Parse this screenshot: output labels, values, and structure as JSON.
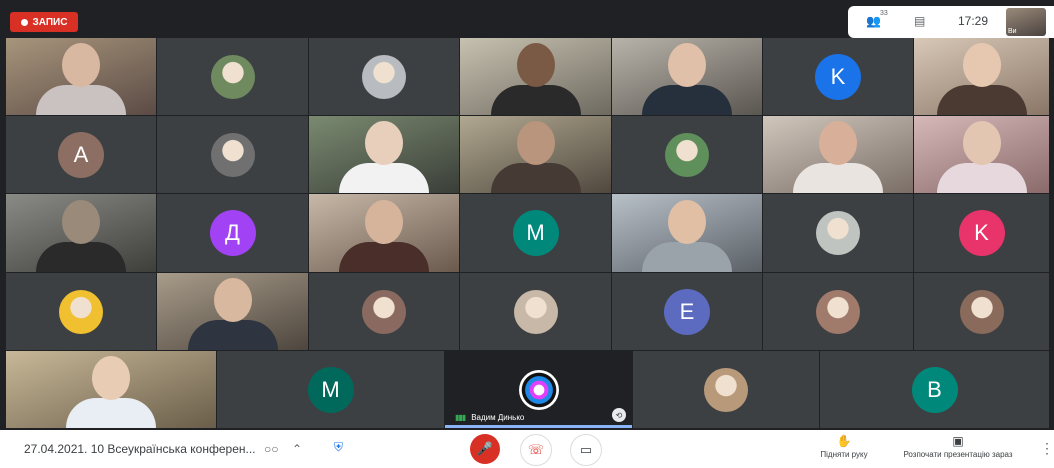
{
  "record_badge": {
    "label": "ЗАПИС",
    "color": "#d93025"
  },
  "topbar": {
    "participants_icon": "people-icon",
    "participants_count": "33",
    "chat_icon": "chat-icon",
    "time": "17:29",
    "self_label": "Ви"
  },
  "tiles": [
    {
      "id": "t1",
      "kind": "photo",
      "a": "#a8957c",
      "b": "#5b4b45",
      "head": "#d8b8a0",
      "body": "#c9c2c0"
    },
    {
      "id": "t2",
      "kind": "pic",
      "pic": "#6f8a5f"
    },
    {
      "id": "t3",
      "kind": "pic",
      "pic": "#b8bcc0"
    },
    {
      "id": "t4",
      "kind": "photo",
      "a": "#c7c1b0",
      "b": "#6e6a60",
      "head": "#7a5a45",
      "body": "#2a2a2a"
    },
    {
      "id": "t5",
      "kind": "photo",
      "a": "#b8b3aa",
      "b": "#5a5650",
      "head": "#e0c0a8",
      "body": "#26303c"
    },
    {
      "id": "t6",
      "kind": "letter",
      "letter": "K",
      "color": "#1a73e8"
    },
    {
      "id": "t7",
      "kind": "photo",
      "a": "#d8c8b8",
      "b": "#8a7666",
      "head": "#e6c8b0",
      "body": "#4a3a32"
    },
    {
      "id": "t8",
      "kind": "letter",
      "letter": "A",
      "color": "#8d6e63"
    },
    {
      "id": "t9",
      "kind": "pic",
      "pic": "#707070"
    },
    {
      "id": "t10",
      "kind": "photo",
      "a": "#7a8a70",
      "b": "#3a3e38",
      "head": "#e8cfbc",
      "body": "#f2f2f2"
    },
    {
      "id": "t11",
      "kind": "photo",
      "a": "#b0a890",
      "b": "#50483e",
      "head": "#b8957c",
      "body": "#463a34"
    },
    {
      "id": "t12",
      "kind": "pic",
      "pic": "#5f8f5a"
    },
    {
      "id": "t13",
      "kind": "photo",
      "a": "#cfc6bc",
      "b": "#7a6e66",
      "head": "#d8b09a",
      "body": "#e9e4e0"
    },
    {
      "id": "t14",
      "kind": "photo",
      "a": "#d6b8b8",
      "b": "#8a6a6a",
      "head": "#e2c6b2",
      "body": "#e6d8dc"
    },
    {
      "id": "t15",
      "kind": "photo",
      "a": "#8a8a86",
      "b": "#3e3e3a",
      "head": "#9a8a7a",
      "body": "#2a2a2a"
    },
    {
      "id": "t16",
      "kind": "letter",
      "letter": "Д",
      "color": "#a142f4"
    },
    {
      "id": "t17",
      "kind": "photo",
      "a": "#c8b8a8",
      "b": "#6a5a4e",
      "head": "#d6b49c",
      "body": "#4a2e2a"
    },
    {
      "id": "t18",
      "kind": "letter",
      "letter": "M",
      "color": "#00897b"
    },
    {
      "id": "t19",
      "kind": "photo",
      "a": "#b8c0c8",
      "b": "#5a6066",
      "head": "#e0bfa4",
      "body": "#9aa2aa"
    },
    {
      "id": "t20",
      "kind": "pic",
      "pic": "#c0c4c0"
    },
    {
      "id": "t21",
      "kind": "letter",
      "letter": "K",
      "color": "#e8346a"
    },
    {
      "id": "t22",
      "kind": "pic",
      "pic": "#f0c030"
    },
    {
      "id": "t23",
      "kind": "photo",
      "a": "#a89c8a",
      "b": "#4e463e",
      "head": "#d8b89e",
      "body": "#2e3440"
    },
    {
      "id": "t24",
      "kind": "pic",
      "pic": "#8a6a60"
    },
    {
      "id": "t25",
      "kind": "pic",
      "pic": "#c8b8a8"
    },
    {
      "id": "t26",
      "kind": "letter",
      "letter": "E",
      "color": "#5c6bc0"
    },
    {
      "id": "t27",
      "kind": "pic",
      "pic": "#a07a6a"
    },
    {
      "id": "t28",
      "kind": "pic",
      "pic": "#8a6a5a"
    },
    {
      "id": "t29",
      "kind": "photo",
      "a": "#c8b898",
      "b": "#6a5e4a",
      "head": "#e8ccb4",
      "body": "#e8eef4"
    },
    {
      "id": "t30",
      "kind": "letter",
      "letter": "M",
      "color": "#00695c"
    },
    {
      "id": "t31",
      "kind": "speaker",
      "pic": "#1a1a1a",
      "name": "Вадим Динько"
    },
    {
      "id": "t32",
      "kind": "pic",
      "pic": "#b89a7a"
    },
    {
      "id": "t33",
      "kind": "letter",
      "letter": "B",
      "color": "#00897b"
    }
  ],
  "bottombar": {
    "meeting_title": "27.04.2021. 10 Всеукраїнська конферен...",
    "raise_hand_label": "Підняти руку",
    "present_label": "Розпочати презентацію зараз",
    "mic_color": "#d93025",
    "hangup_color": "#d93025"
  }
}
